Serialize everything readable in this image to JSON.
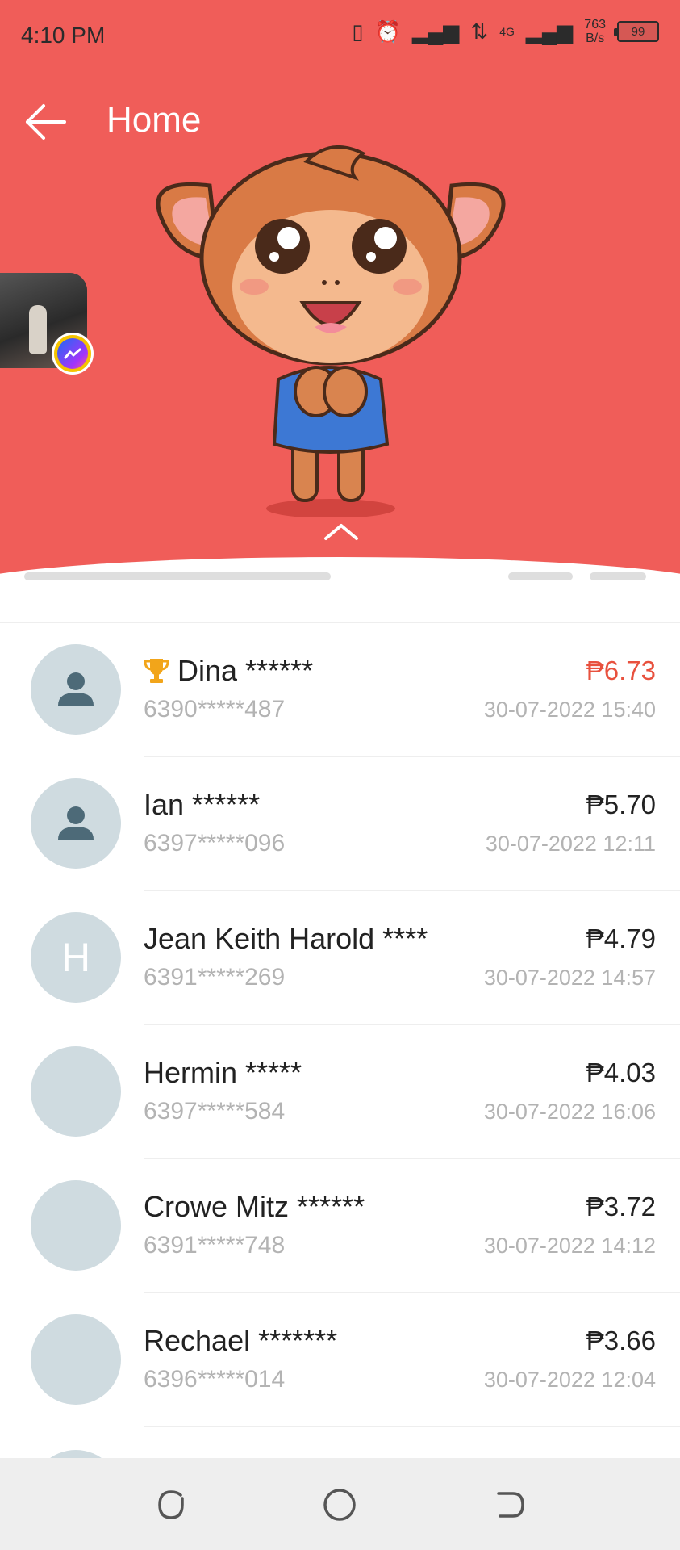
{
  "status_bar": {
    "time": "4:10 PM",
    "network_label": "4G",
    "speed_value": "763",
    "speed_unit": "B/s",
    "battery": "99"
  },
  "header": {
    "title": "Home"
  },
  "icons": {
    "back": "back-arrow-icon",
    "expand": "chevron-up-icon",
    "messenger": "messenger-icon",
    "trophy": "trophy-icon",
    "default_avatar": "person-icon"
  },
  "colors": {
    "header_bg": "#f05d59",
    "amount_highlight": "#e8513e",
    "letter_avatar_bg": "#5629a6"
  },
  "rows": [
    {
      "name": "Dina ******",
      "phone": "6390*****487",
      "amount": "₱6.73",
      "date": "30-07-2022 15:40",
      "avatar": "person-icon",
      "top_rank": true
    },
    {
      "name": "Ian ******",
      "phone": "6397*****096",
      "amount": "₱5.70",
      "date": "30-07-2022 12:11",
      "avatar": "person-icon"
    },
    {
      "name": "Jean Keith Harold ****",
      "phone": "6391*****269",
      "amount": "₱4.79",
      "date": "30-07-2022 14:57",
      "avatar_letter": "H"
    },
    {
      "name": "Hermin *****",
      "phone": "6397*****584",
      "amount": "₱4.03",
      "date": "30-07-2022 16:06",
      "avatar": "photo"
    },
    {
      "name": "Crowe Mitz ******",
      "phone": "6391*****748",
      "amount": "₱3.72",
      "date": "30-07-2022 14:12",
      "avatar": "photo"
    },
    {
      "name": "Rechael *******",
      "phone": "6396*****014",
      "amount": "₱3.66",
      "date": "30-07-2022 12:04",
      "avatar": "photo"
    }
  ],
  "nav_bar": {
    "recent": "recent-apps-icon",
    "home": "home-circle-icon",
    "back": "back-nav-icon"
  }
}
